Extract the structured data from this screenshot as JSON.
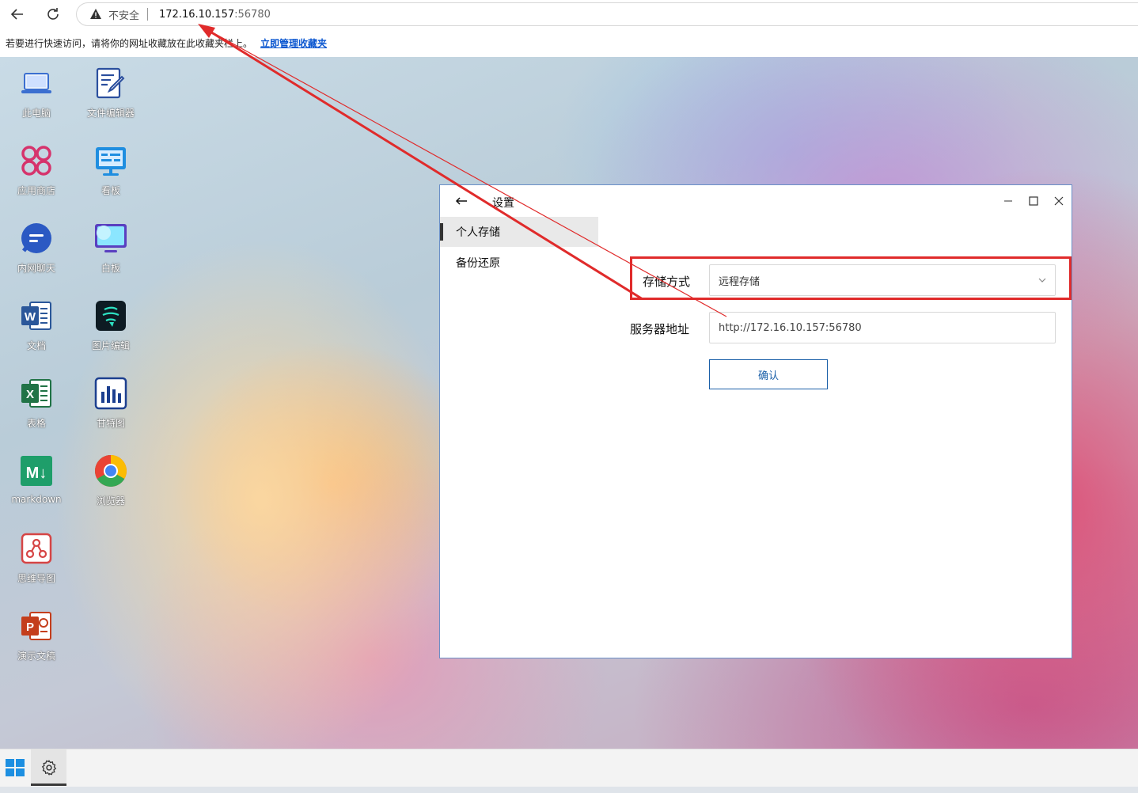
{
  "browser": {
    "security_label": "不安全",
    "url_host": "172.16.10.157",
    "url_port": ":56780",
    "bookmark_hint": "若要进行快速访问，请将你的网址收藏放在此收藏夹栏上。",
    "bookmark_link": "立即管理收藏夹"
  },
  "desktop_icons": [
    {
      "label": "此电脑",
      "icon": "laptop-icon"
    },
    {
      "label": "文件编辑器",
      "icon": "file-editor-icon"
    },
    {
      "label": "应用商店",
      "icon": "app-store-icon"
    },
    {
      "label": "看板",
      "icon": "kanban-icon"
    },
    {
      "label": "内网聊天",
      "icon": "chat-icon"
    },
    {
      "label": "白板",
      "icon": "whiteboard-icon"
    },
    {
      "label": "文档",
      "icon": "word-icon"
    },
    {
      "label": "图片编辑",
      "icon": "image-editor-icon"
    },
    {
      "label": "表格",
      "icon": "excel-icon"
    },
    {
      "label": "甘特图",
      "icon": "gantt-icon"
    },
    {
      "label": "markdown",
      "icon": "markdown-icon"
    },
    {
      "label": "浏览器",
      "icon": "chrome-icon"
    },
    {
      "label": "思维导图",
      "icon": "mindmap-icon"
    },
    {
      "label": "演示文稿",
      "icon": "ppt-icon"
    }
  ],
  "settings_window": {
    "title": "设置",
    "sidebar": [
      {
        "label": "个人存储",
        "active": true
      },
      {
        "label": "备份还原",
        "active": false
      }
    ],
    "storage_label": "存储方式",
    "storage_value": "远程存储",
    "server_label": "服务器地址",
    "server_value": "http://172.16.10.157:56780",
    "confirm_label": "确认"
  },
  "colors": {
    "annotation_red": "#e02b2b",
    "accent_blue": "#1a5fa8"
  }
}
